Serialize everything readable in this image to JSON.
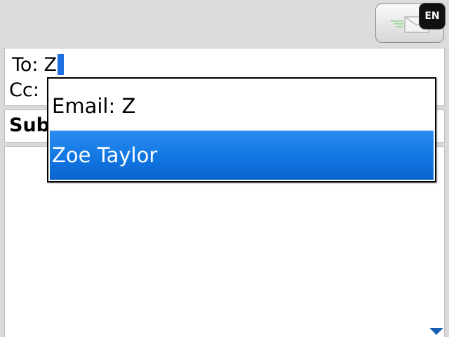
{
  "top_bar": {
    "send_icon": "envelope-send-icon",
    "language": "EN"
  },
  "compose": {
    "to_label": "To:",
    "to_value": "Z",
    "cc_label": "Cc:",
    "subject_label": "Sub"
  },
  "autocomplete": {
    "items": [
      {
        "label": "Email: Z"
      },
      {
        "label": "Zoe Taylor",
        "selected": true
      }
    ]
  },
  "colors": {
    "accent": "#1277e2",
    "caret": "#1d6ee0"
  }
}
